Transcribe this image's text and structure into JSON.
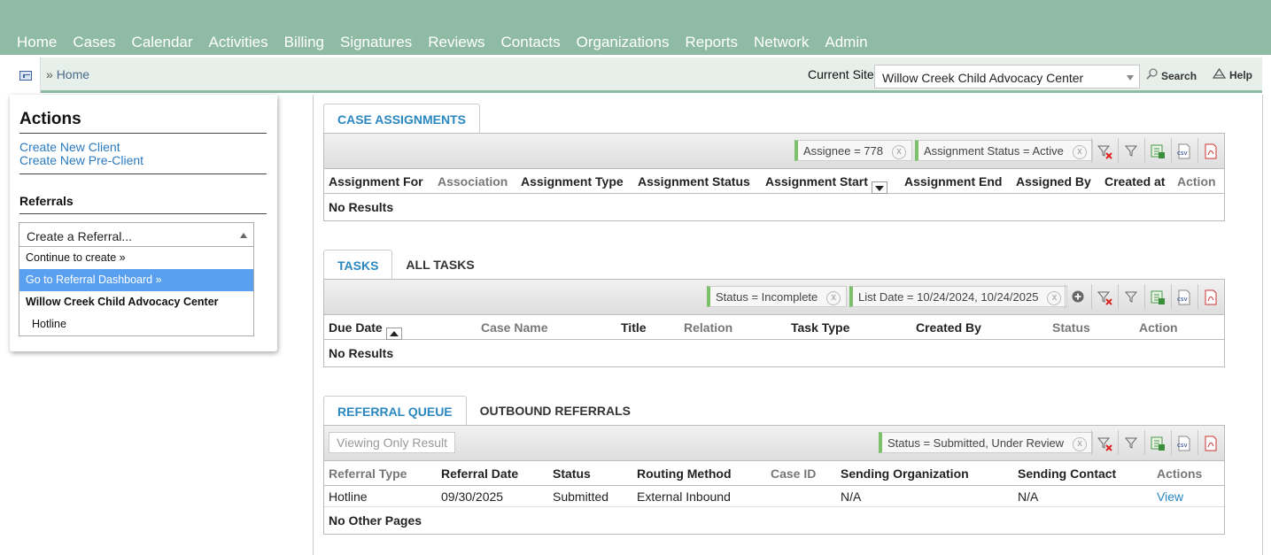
{
  "nav": [
    "Home",
    "Cases",
    "Calendar",
    "Activities",
    "Billing",
    "Signatures",
    "Reviews",
    "Contacts",
    "Organizations",
    "Reports",
    "Network",
    "Admin"
  ],
  "breadcrumb": {
    "sep": "»",
    "home": "Home"
  },
  "site": {
    "label": "Current Site",
    "value": "Willow Creek Child Advocacy Center"
  },
  "tools": {
    "search": "Search",
    "help": "Help"
  },
  "actions": {
    "title": "Actions",
    "create_client": "Create New Client",
    "create_pre_client": "Create New Pre-Client"
  },
  "referrals": {
    "title": "Referrals",
    "select_value": "Create a Referral...",
    "options": [
      "Continue to create »",
      "Go to Referral Dashboard »"
    ],
    "group": "Willow Creek Child Advocacy Center",
    "group_items": [
      "Hotline"
    ]
  },
  "case_assignments": {
    "tab": "CASE ASSIGNMENTS",
    "filters": [
      "Assignee = 778",
      "Assignment Status = Active"
    ],
    "columns": [
      "Assignment For",
      "Association",
      "Assignment Type",
      "Assignment Status",
      "Assignment Start",
      "Assignment End",
      "Assigned By",
      "Created at",
      "Action"
    ],
    "empty": "No Results"
  },
  "tasks": {
    "tabs": [
      "TASKS",
      "ALL TASKS"
    ],
    "filters": [
      "Status = Incomplete",
      "List Date = 10/24/2024, 10/24/2025"
    ],
    "columns": [
      "Due Date",
      "Case Name",
      "Title",
      "Relation",
      "Task Type",
      "Created By",
      "Status",
      "Action"
    ],
    "empty": "No Results"
  },
  "referral_queue": {
    "tabs": [
      "REFERRAL QUEUE",
      "OUTBOUND REFERRALS"
    ],
    "viewing": "Viewing Only Result",
    "filters": [
      "Status = Submitted, Under Review"
    ],
    "columns": [
      "Referral Type",
      "Referral Date",
      "Status",
      "Routing Method",
      "Case ID",
      "Sending Organization",
      "Sending Contact",
      "Actions"
    ],
    "rows": [
      {
        "type": "Hotline",
        "date": "09/30/2025",
        "status": "Submitted",
        "routing": "External Inbound",
        "case_id": "",
        "org": "N/A",
        "contact": "N/A",
        "action": "View"
      }
    ],
    "footer": "No Other Pages"
  },
  "filter_remove": "x",
  "csv_label": "csv"
}
